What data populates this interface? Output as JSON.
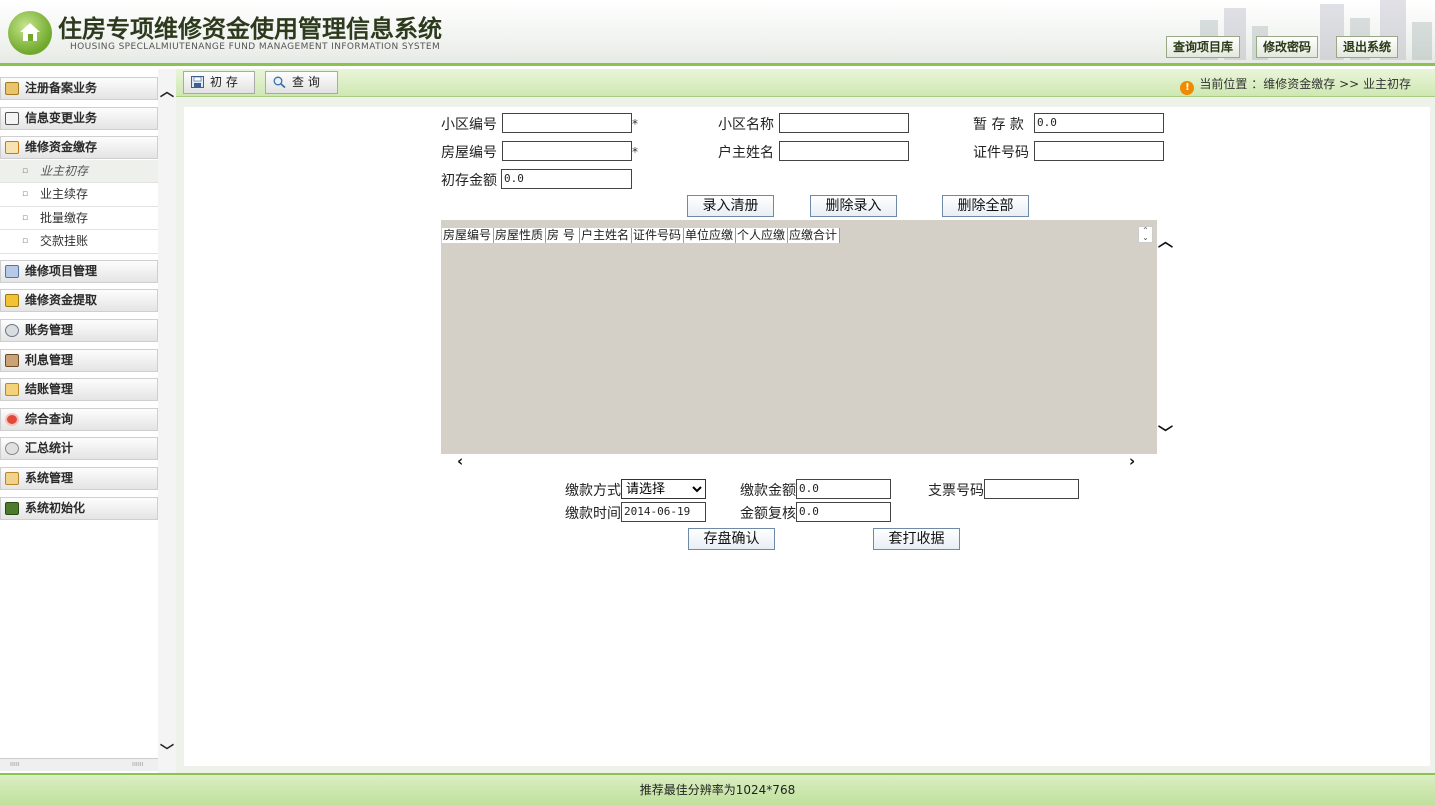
{
  "header": {
    "title_cn": "住房专项维修资金使用管理信息系统",
    "title_en": "HOUSING SPECLALMIUTENANGE FUND MANAGEMENT INFORMATION SYSTEM",
    "buttons": [
      "查询项目库",
      "修改密码",
      "退出系统"
    ]
  },
  "sidebar": {
    "menu": [
      {
        "label": "注册备案业务",
        "icon": "register-icon"
      },
      {
        "label": "信息变更业务",
        "icon": "info-change-icon"
      },
      {
        "label": "维修资金缴存",
        "icon": "deposit-icon"
      },
      {
        "label": "维修项目管理",
        "icon": "project-icon"
      },
      {
        "label": "维修资金提取",
        "icon": "withdraw-icon"
      },
      {
        "label": "账务管理",
        "icon": "accounting-icon"
      },
      {
        "label": "利息管理",
        "icon": "interest-icon"
      },
      {
        "label": "结账管理",
        "icon": "settlement-icon"
      },
      {
        "label": "综合查询",
        "icon": "query-icon"
      },
      {
        "label": "汇总统计",
        "icon": "statistics-icon"
      },
      {
        "label": "系统管理",
        "icon": "system-icon"
      },
      {
        "label": "系统初始化",
        "icon": "init-icon"
      }
    ],
    "sub_items": [
      "业主初存",
      "业主续存",
      "批量缴存",
      "交款挂账"
    ],
    "active_sub": "业主初存"
  },
  "toolbar": {
    "btn_init": "初 存",
    "btn_query": "查 询",
    "location_label": "当前位置 ：",
    "location_path": "维修资金缴存 >> 业主初存"
  },
  "form": {
    "community_code_label": "小区编号",
    "community_code_value": "",
    "community_name_label": "小区名称",
    "community_name_value": "",
    "temp_deposit_label": "暂 存 款",
    "temp_deposit_value": "0.0",
    "house_code_label": "房屋编号",
    "house_code_value": "",
    "owner_name_label": "户主姓名",
    "owner_name_value": "",
    "id_number_label": "证件号码",
    "id_number_value": "",
    "init_amount_label": "初存金额",
    "init_amount_value": "0.0",
    "required_mark": "*"
  },
  "actions": {
    "enter_list": "录入清册",
    "delete_entry": "删除录入",
    "delete_all": "删除全部"
  },
  "grid": {
    "columns": [
      "房屋编号",
      "房屋性质",
      "房 号",
      "户主姓名",
      "证件号码",
      "单位应缴",
      "个人应缴",
      "应缴合计"
    ]
  },
  "payment": {
    "method_label": "缴款方式",
    "method_value": "请选择",
    "amount_label": "缴款金额",
    "amount_value": "0.0",
    "cheque_label": "支票号码",
    "cheque_value": "",
    "time_label": "缴款时间",
    "time_value": "2014-06-19",
    "review_label": "金额复核",
    "review_value": "0.0",
    "confirm_button": "存盘确认",
    "print_button": "套打收据"
  },
  "footer": {
    "text": "推荐最佳分辨率为1024*768"
  }
}
